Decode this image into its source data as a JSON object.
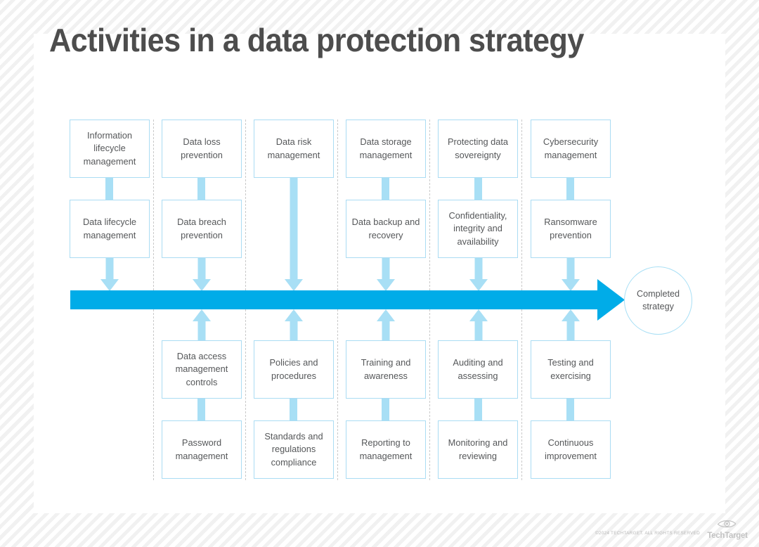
{
  "page": {
    "title": "Activities in a data protection strategy",
    "accent_color": "#00ace8",
    "light_accent_color": "#a8dff5",
    "box_border_color": "#aadcf3",
    "text_color": "#555759",
    "title_color": "#4d4d4d",
    "separator_color": "#c9c9c9"
  },
  "columns": [
    {
      "index": 1,
      "above": [
        "Information lifecycle management",
        "Data lifecycle management"
      ],
      "below": []
    },
    {
      "index": 2,
      "above": [
        "Data loss prevention",
        "Data breach prevention"
      ],
      "below": [
        "Data access management controls",
        "Password management"
      ]
    },
    {
      "index": 3,
      "above": [
        "Data risk management"
      ],
      "below": [
        "Policies and procedures",
        "Standards and regulations compliance"
      ]
    },
    {
      "index": 4,
      "above": [
        "Data storage management",
        "Data backup and recovery"
      ],
      "below": [
        "Training and awareness",
        "Reporting to management"
      ]
    },
    {
      "index": 5,
      "above": [
        "Protecting data sovereignty",
        "Confidentiality, integrity and availability"
      ],
      "below": [
        "Auditing and assessing",
        "Monitoring and reviewing"
      ]
    },
    {
      "index": 6,
      "above": [
        "Cybersecurity management",
        "Ransomware prevention"
      ],
      "below": [
        "Testing and exercising",
        "Continuous improvement"
      ]
    }
  ],
  "boxes": {
    "r1c1": "Information lifecycle management",
    "r1c2": "Data loss prevention",
    "r1c3": "Data risk management",
    "r1c4": "Data storage management",
    "r1c5": "Protecting data sovereignty",
    "r1c6": "Cybersecurity management",
    "r2c1": "Data lifecycle management",
    "r2c2": "Data breach prevention",
    "r2c4": "Data backup and recovery",
    "r2c5": "Confidentiality, integrity and availability",
    "r2c6": "Ransomware prevention",
    "r3c2": "Data access management controls",
    "r3c3": "Policies and procedures",
    "r3c4": "Training and awareness",
    "r3c5": "Auditing and assessing",
    "r3c6": "Testing and exercising",
    "r4c2": "Password management",
    "r4c3": "Standards and regulations compliance",
    "r4c4": "Reporting to management",
    "r4c5": "Monitoring and reviewing",
    "r4c6": "Continuous improvement"
  },
  "outcome": {
    "label": "Completed strategy"
  },
  "footer": {
    "copyright": "©2024 TECHTARGET. ALL RIGHTS RESERVED",
    "brand": "TechTarget",
    "logo_icon": "eye-icon"
  }
}
